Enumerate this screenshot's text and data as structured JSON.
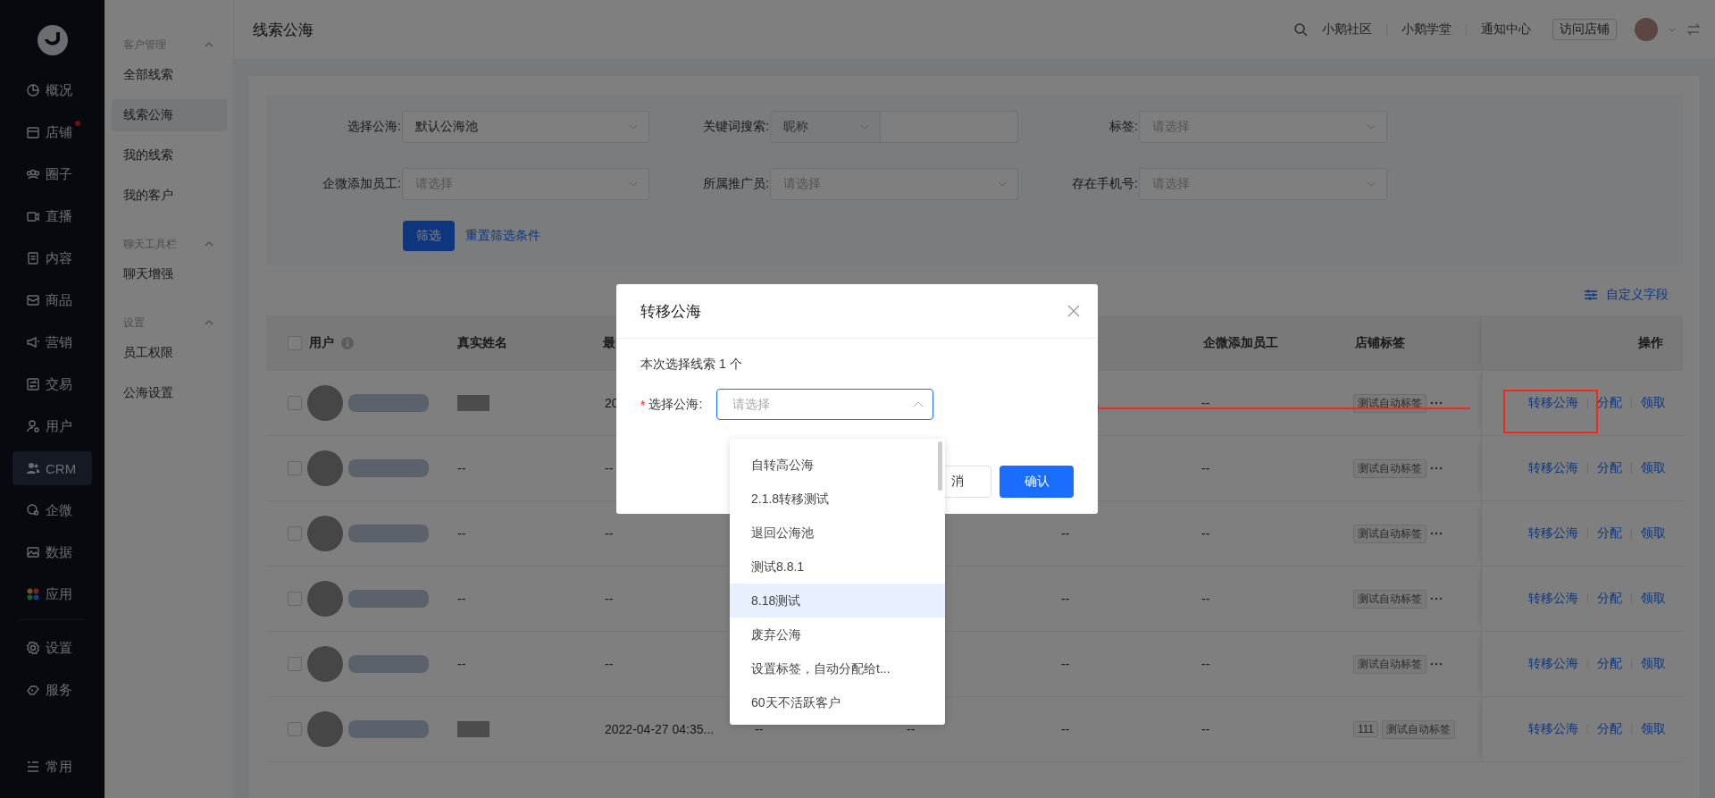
{
  "nav": {
    "items": [
      {
        "label": "概况",
        "selected": false,
        "badge": false
      },
      {
        "label": "店铺",
        "selected": false,
        "badge": true
      },
      {
        "label": "圈子",
        "selected": false,
        "badge": false
      },
      {
        "label": "直播",
        "selected": false,
        "badge": false
      },
      {
        "label": "内容",
        "selected": false,
        "badge": false
      },
      {
        "label": "商品",
        "selected": false,
        "badge": false
      },
      {
        "label": "营销",
        "selected": false,
        "badge": false
      },
      {
        "label": "交易",
        "selected": false,
        "badge": false
      },
      {
        "label": "用户",
        "selected": false,
        "badge": false
      },
      {
        "label": "CRM",
        "selected": true,
        "badge": false
      },
      {
        "label": "企微",
        "selected": false,
        "badge": false
      },
      {
        "label": "数据",
        "selected": false,
        "badge": false
      },
      {
        "label": "应用",
        "selected": false,
        "badge": false
      }
    ],
    "bottom_items": [
      {
        "label": "设置",
        "selected": false
      },
      {
        "label": "服务",
        "selected": false
      }
    ],
    "footer_item": "常用"
  },
  "subnav": {
    "groups": [
      {
        "title": "客户管理",
        "expanded": true,
        "items": [
          {
            "label": "全部线索",
            "selected": false
          },
          {
            "label": "线索公海",
            "selected": true
          },
          {
            "label": "我的线索",
            "selected": false
          },
          {
            "label": "我的客户",
            "selected": false
          }
        ]
      },
      {
        "title": "聊天工具栏",
        "expanded": true,
        "items": [
          {
            "label": "聊天增强",
            "selected": false
          }
        ]
      },
      {
        "title": "设置",
        "expanded": true,
        "items": [
          {
            "label": "员工权限",
            "selected": false
          },
          {
            "label": "公海设置",
            "selected": false
          }
        ]
      }
    ]
  },
  "header": {
    "title": "线索公海",
    "links": [
      "小鹅社区",
      "小鹅学堂",
      "通知中心"
    ],
    "visit_button": "访问店铺"
  },
  "filters": {
    "rows": [
      [
        {
          "label": "选择公海:",
          "kind": "select",
          "value": "默认公海池"
        },
        {
          "label": "关键词搜索:",
          "kind": "keyword",
          "option": "昵称"
        },
        {
          "label": "标签:",
          "kind": "select",
          "placeholder": "请选择"
        }
      ],
      [
        {
          "label": "企微添加员工:",
          "kind": "select",
          "placeholder": "请选择"
        },
        {
          "label": "所属推广员:",
          "kind": "select",
          "placeholder": "请选择"
        },
        {
          "label": "存在手机号:",
          "kind": "select",
          "placeholder": "请选择"
        }
      ]
    ],
    "submit": "筛选",
    "reset": "重置筛选条件"
  },
  "custom_fields": "自定义字段",
  "table": {
    "all_checked": false,
    "user_column": "用户",
    "columns": [
      "真实姓名",
      "最",
      null,
      null,
      null,
      "企微添加员工",
      "店铺标签",
      "操作"
    ],
    "rows": [
      {
        "checked": false,
        "real_name_blurred": true,
        "cells": [
          null,
          "20",
          null,
          null,
          null,
          "--"
        ],
        "tags": [
          "测试自动标签"
        ],
        "tags_more": true,
        "actions": [
          "转移公海",
          "分配",
          "领取"
        ]
      },
      {
        "checked": false,
        "real_name_blurred": false,
        "cells": [
          "--",
          "--",
          null,
          null,
          null,
          "--"
        ],
        "tags": [
          "测试自动标签"
        ],
        "tags_more": true,
        "actions": [
          "转移公海",
          "分配",
          "领取"
        ]
      },
      {
        "checked": false,
        "real_name_blurred": false,
        "cells": [
          "--",
          "--",
          null,
          null,
          "--",
          "--"
        ],
        "tags": [
          "测试自动标签"
        ],
        "tags_more": true,
        "actions": [
          "转移公海",
          "分配",
          "领取"
        ]
      },
      {
        "checked": false,
        "real_name_blurred": false,
        "cells": [
          "--",
          "--",
          null,
          null,
          "--",
          "--"
        ],
        "tags": [
          "测试自动标签"
        ],
        "tags_more": true,
        "actions": [
          "转移公海",
          "分配",
          "领取"
        ]
      },
      {
        "checked": false,
        "real_name_blurred": false,
        "cells": [
          "--",
          "--",
          null,
          null,
          "--",
          "--"
        ],
        "tags": [
          "测试自动标签"
        ],
        "tags_more": true,
        "actions": [
          "转移公海",
          "分配",
          "领取"
        ]
      },
      {
        "checked": false,
        "real_name_blurred": true,
        "cells": [
          null,
          "2022-04-27 04:35...",
          "--",
          "--",
          "--",
          "--"
        ],
        "tags": [
          "111",
          "测试自动标签"
        ],
        "tags_more": false,
        "actions": [
          "转移公海",
          "分配",
          "领取"
        ]
      }
    ]
  },
  "modal": {
    "title": "转移公海",
    "summary": "本次选择线索 1 个",
    "field_label": "选择公海:",
    "required_mark": "*",
    "placeholder": "请选择",
    "open": true,
    "cancel": "消",
    "confirm": "确认",
    "options": [
      {
        "label": "自转高公海",
        "selected": false
      },
      {
        "label": "2.1.8转移测试",
        "selected": false
      },
      {
        "label": "退回公海池",
        "selected": false
      },
      {
        "label": "测试8.8.1",
        "selected": false
      },
      {
        "label": "8.18测试",
        "selected": true
      },
      {
        "label": "废弃公海",
        "selected": false
      },
      {
        "label": "设置标签，自动分配给t...",
        "selected": false
      },
      {
        "label": "60天不活跃客户",
        "selected": false
      }
    ]
  },
  "annotations": {
    "arrow": true,
    "highlight_box": true
  }
}
